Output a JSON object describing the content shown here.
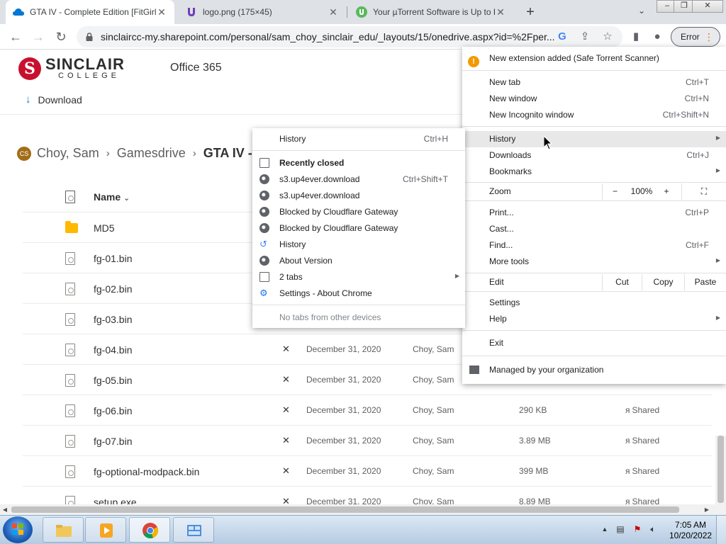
{
  "tabs": [
    {
      "title": "GTA IV - Complete Edition [FitGirl Repack]",
      "close": "✕"
    },
    {
      "title": "logo.png (175×45)",
      "close": "✕"
    },
    {
      "title": "Your µTorrent Software is Up to Date",
      "close": "✕"
    }
  ],
  "tabstrip": {
    "new_tab": "+",
    "tab_search": "⌄"
  },
  "window_controls": {
    "minimize": "‒",
    "maximize": "❐",
    "close": "✕"
  },
  "toolbar": {
    "url": "sinclaircc-my.sharepoint.com/personal/sam_choy_sinclair_edu/_layouts/15/onedrive.aspx?id=%2Fper...",
    "error_label": "Error",
    "error_dots": "⋮"
  },
  "header": {
    "logo_mark": "S",
    "logo_word1": "SINCLAIR",
    "logo_word2": "COLLEGE",
    "app_name": "Office 365"
  },
  "commandbar": {
    "download_label": "Download",
    "download_icon": "↓"
  },
  "breadcrumb": {
    "avatar_initials": "CS",
    "items": [
      "Choy, Sam",
      "Gamesdrive",
      "GTA IV -"
    ],
    "separator": "›"
  },
  "filelist": {
    "name_header": "Name",
    "name_header_sort": "⌄",
    "rows": [
      {
        "name": "MD5",
        "type": "folder",
        "date": "",
        "by": "",
        "size": "",
        "share": ""
      },
      {
        "name": "fg-01.bin",
        "type": "file",
        "date": "",
        "by": "",
        "size": "",
        "share": ""
      },
      {
        "name": "fg-02.bin",
        "type": "file",
        "date": "",
        "by": "",
        "size": "",
        "share": ""
      },
      {
        "name": "fg-03.bin",
        "type": "file",
        "date": "",
        "by": "",
        "size": "",
        "share": ""
      },
      {
        "name": "fg-04.bin",
        "type": "file",
        "date": "December 31, 2020",
        "by": "Choy, Sam",
        "size": "",
        "share": ""
      },
      {
        "name": "fg-05.bin",
        "type": "file",
        "date": "December 31, 2020",
        "by": "Choy, Sam",
        "size": "",
        "share": ""
      },
      {
        "name": "fg-06.bin",
        "type": "file",
        "date": "December 31, 2020",
        "by": "Choy, Sam",
        "size": "290 KB",
        "share": "Shared"
      },
      {
        "name": "fg-07.bin",
        "type": "file",
        "date": "December 31, 2020",
        "by": "Choy, Sam",
        "size": "3.89 MB",
        "share": "Shared"
      },
      {
        "name": "fg-optional-modpack.bin",
        "type": "file",
        "date": "December 31, 2020",
        "by": "Choy, Sam",
        "size": "399 MB",
        "share": "Shared"
      },
      {
        "name": "setup.exe",
        "type": "file",
        "date": "December 31, 2020",
        "by": "Choy, Sam",
        "size": "8.89 MB",
        "share": "Shared"
      }
    ],
    "share_icon": "ᴙ",
    "activity_icon": "✕"
  },
  "chrome_menu": {
    "extension_notice": "New extension added (Safe Torrent Scanner)",
    "items": [
      {
        "label": "New tab",
        "shortcut": "Ctrl+T"
      },
      {
        "label": "New window",
        "shortcut": "Ctrl+N"
      },
      {
        "label": "New Incognito window",
        "shortcut": "Ctrl+Shift+N"
      },
      {
        "label": "History",
        "shortcut": ""
      },
      {
        "label": "Downloads",
        "shortcut": "Ctrl+J"
      },
      {
        "label": "Bookmarks",
        "shortcut": ""
      },
      {
        "label": "Print...",
        "shortcut": "Ctrl+P"
      },
      {
        "label": "Cast...",
        "shortcut": ""
      },
      {
        "label": "Find...",
        "shortcut": "Ctrl+F"
      },
      {
        "label": "More tools",
        "shortcut": ""
      },
      {
        "label": "Settings",
        "shortcut": ""
      },
      {
        "label": "Help",
        "shortcut": ""
      },
      {
        "label": "Exit",
        "shortcut": ""
      }
    ],
    "zoom": {
      "label": "Zoom",
      "minus": "−",
      "value": "100%",
      "plus": "+",
      "fullscreen": "⛶"
    },
    "edit": {
      "label": "Edit",
      "cut": "Cut",
      "copy": "Copy",
      "paste": "Paste"
    },
    "managed": "Managed by your organization",
    "submenu_arrow": "▶"
  },
  "history_menu": {
    "history": {
      "label": "History",
      "shortcut": "Ctrl+H"
    },
    "recently_closed": "Recently closed",
    "items": [
      {
        "label": "s3.up4ever.download",
        "shortcut": "Ctrl+Shift+T",
        "icon": "globe-icon"
      },
      {
        "label": "s3.up4ever.download",
        "shortcut": "",
        "icon": "globe-icon"
      },
      {
        "label": "Blocked by Cloudflare Gateway",
        "shortcut": "",
        "icon": "globe-icon"
      },
      {
        "label": "Blocked by Cloudflare Gateway",
        "shortcut": "",
        "icon": "globe-icon"
      },
      {
        "label": "History",
        "shortcut": "",
        "icon": "history-icon"
      },
      {
        "label": "About Version",
        "shortcut": "",
        "icon": "globe-icon"
      },
      {
        "label": "2 tabs",
        "shortcut": "",
        "icon": "window-icon"
      },
      {
        "label": "Settings - About Chrome",
        "shortcut": "",
        "icon": "settings-icon"
      }
    ],
    "no_tabs": "No tabs from other devices"
  },
  "taskbar": {
    "time": "7:05 AM",
    "date": "10/20/2022"
  },
  "colors": {
    "brand_red": "#c8102e",
    "onedrive_blue": "#0078d4",
    "warning_orange": "#f29900"
  }
}
